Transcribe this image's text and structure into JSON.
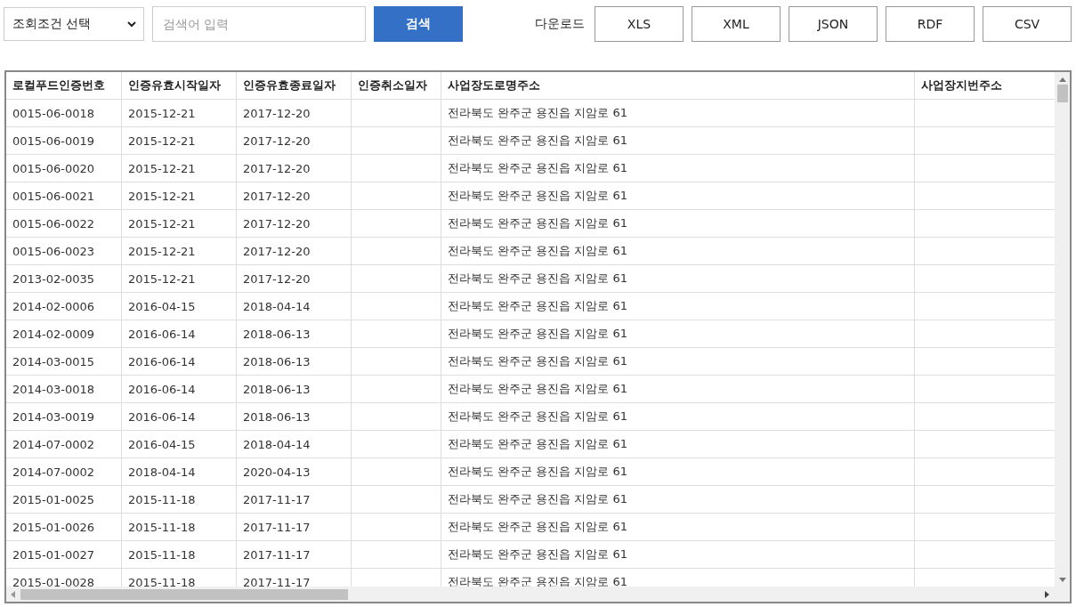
{
  "toolbar": {
    "condition_select": "조회조건 선택",
    "search": {
      "placeholder": "검색어 입력"
    },
    "search_button": "검색",
    "download_label": "다운로드",
    "download_buttons": [
      "XLS",
      "XML",
      "JSON",
      "RDF",
      "CSV"
    ]
  },
  "table": {
    "columns": [
      "로컬푸드인증번호",
      "인증유효시작일자",
      "인증유효종료일자",
      "인증취소일자",
      "사업장도로명주소",
      "사업장지번주소"
    ],
    "rows": [
      [
        "0015-06-0018",
        "2015-12-21",
        "2017-12-20",
        "",
        "전라북도 완주군 용진읍 지암로 61",
        ""
      ],
      [
        "0015-06-0019",
        "2015-12-21",
        "2017-12-20",
        "",
        "전라북도 완주군 용진읍 지암로 61",
        ""
      ],
      [
        "0015-06-0020",
        "2015-12-21",
        "2017-12-20",
        "",
        "전라북도 완주군 용진읍 지암로 61",
        ""
      ],
      [
        "0015-06-0021",
        "2015-12-21",
        "2017-12-20",
        "",
        "전라북도 완주군 용진읍 지암로 61",
        ""
      ],
      [
        "0015-06-0022",
        "2015-12-21",
        "2017-12-20",
        "",
        "전라북도 완주군 용진읍 지암로 61",
        ""
      ],
      [
        "0015-06-0023",
        "2015-12-21",
        "2017-12-20",
        "",
        "전라북도 완주군 용진읍 지암로 61",
        ""
      ],
      [
        "2013-02-0035",
        "2015-12-21",
        "2017-12-20",
        "",
        "전라북도 완주군 용진읍 지암로 61",
        ""
      ],
      [
        "2014-02-0006",
        "2016-04-15",
        "2018-04-14",
        "",
        "전라북도 완주군 용진읍 지암로 61",
        ""
      ],
      [
        "2014-02-0009",
        "2016-06-14",
        "2018-06-13",
        "",
        "전라북도 완주군 용진읍 지암로 61",
        ""
      ],
      [
        "2014-03-0015",
        "2016-06-14",
        "2018-06-13",
        "",
        "전라북도 완주군 용진읍 지암로 61",
        ""
      ],
      [
        "2014-03-0018",
        "2016-06-14",
        "2018-06-13",
        "",
        "전라북도 완주군 용진읍 지암로 61",
        ""
      ],
      [
        "2014-03-0019",
        "2016-06-14",
        "2018-06-13",
        "",
        "전라북도 완주군 용진읍 지암로 61",
        ""
      ],
      [
        "2014-07-0002",
        "2016-04-15",
        "2018-04-14",
        "",
        "전라북도 완주군 용진읍 지암로 61",
        ""
      ],
      [
        "2014-07-0002",
        "2018-04-14",
        "2020-04-13",
        "",
        "전라북도 완주군 용진읍 지암로 61",
        ""
      ],
      [
        "2015-01-0025",
        "2015-11-18",
        "2017-11-17",
        "",
        "전라북도 완주군 용진읍 지암로 61",
        ""
      ],
      [
        "2015-01-0026",
        "2015-11-18",
        "2017-11-17",
        "",
        "전라북도 완주군 용진읍 지암로 61",
        ""
      ],
      [
        "2015-01-0027",
        "2015-11-18",
        "2017-11-17",
        "",
        "전라북도 완주군 용진읍 지암로 61",
        ""
      ],
      [
        "2015-01-0028",
        "2015-11-18",
        "2017-11-17",
        "",
        "전라북도 완주군 용진읍 지암로 61",
        ""
      ]
    ]
  }
}
